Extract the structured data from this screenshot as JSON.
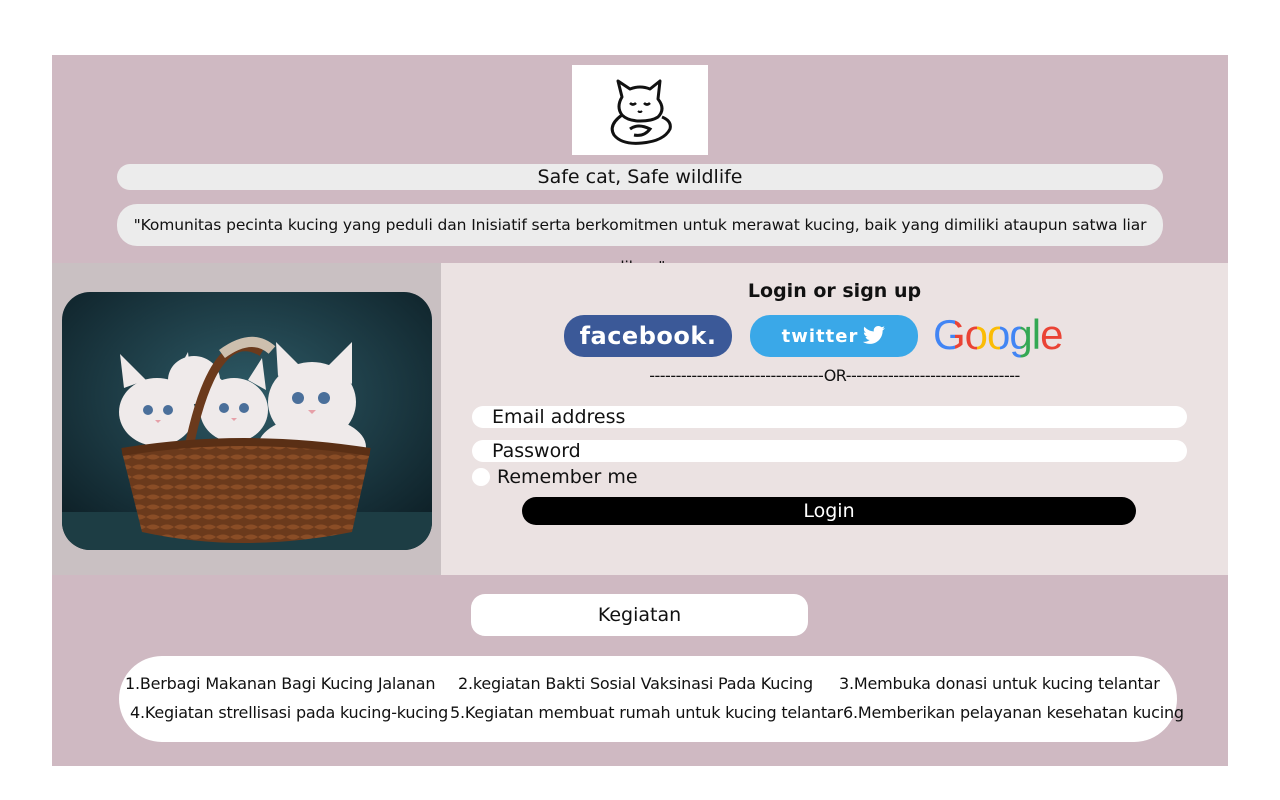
{
  "header": {
    "tagline": "Safe cat, Safe wildlife",
    "quote": "\"Komunitas pecinta kucing yang peduli dan Inisiatif  serta berkomitmen untuk merawat kucing, baik yang dimiliki ataupun satwa liar diluar\""
  },
  "login": {
    "title": "Login or sign up",
    "facebook_label": "facebook.",
    "twitter_label": "twitter",
    "google_label": "Google",
    "or_divider": "---------------------------------OR---------------------------------",
    "email_placeholder": "Email address",
    "password_placeholder": "Password",
    "remember_label": "Remember me",
    "login_button": "Login"
  },
  "kegiatan": {
    "title": "Kegiatan",
    "items": [
      "1.Berbagi Makanan Bagi Kucing Jalanan",
      "2.kegiatan Bakti Sosial Vaksinasi Pada Kucing",
      "3.Membuka donasi untuk kucing telantar",
      "4.Kegiatan strellisasi pada kucing-kucing",
      "5.Kegiatan membuat rumah untuk kucing telantar",
      "6.Memberikan pelayanan kesehatan kucing"
    ]
  },
  "colors": {
    "page_bg": "#cfb9c2",
    "facebook": "#3b5998",
    "twitter": "#3aa8e8",
    "login_button": "#000000"
  },
  "icons": [
    "cat-logo-icon",
    "cat-photo",
    "facebook-logo",
    "twitter-logo",
    "google-logo"
  ]
}
